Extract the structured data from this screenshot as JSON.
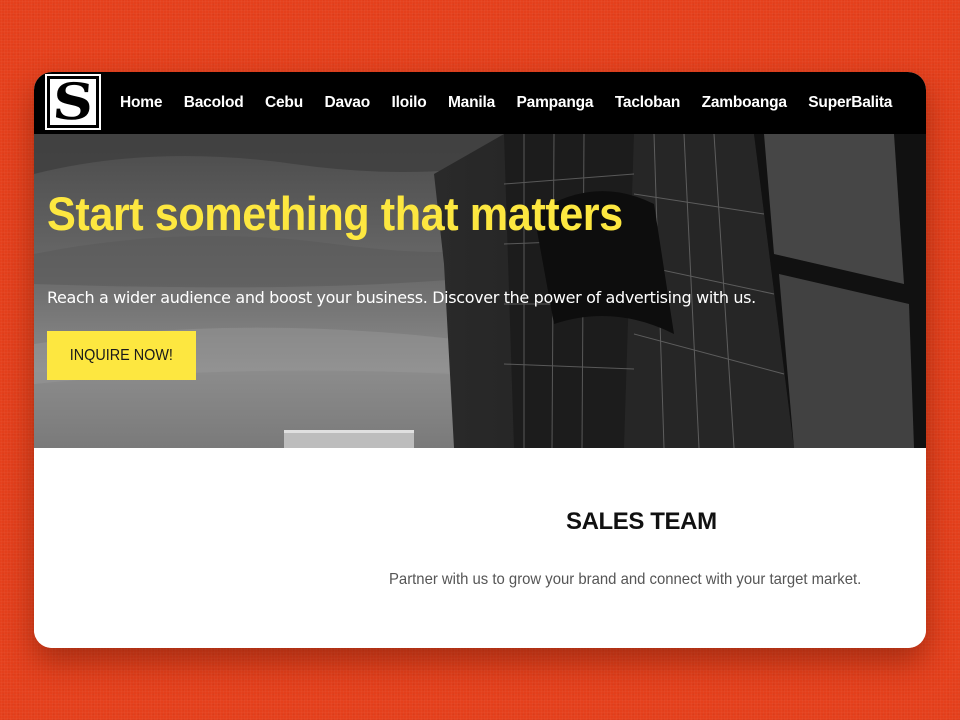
{
  "brand": {
    "logo_letter": "S"
  },
  "nav": {
    "items": [
      "Home",
      "Bacolod",
      "Cebu",
      "Davao",
      "Iloilo",
      "Manila",
      "Pampanga",
      "Tacloban",
      "Zamboanga",
      "SuperBalita"
    ]
  },
  "hero": {
    "title": "Start something that matters",
    "subtitle": "Reach a wider audience and boost your business. Discover the power of advertising with us.",
    "cta_label": "INQUIRE NOW!"
  },
  "sales": {
    "title": "SALES TEAM",
    "subtitle": "Partner with us to grow your brand and connect with your target market."
  },
  "colors": {
    "page_background": "#e5401c",
    "accent_yellow": "#fde740",
    "navbar": "#000000"
  },
  "icons": {
    "logo": "superbalita-s-logo-icon"
  }
}
